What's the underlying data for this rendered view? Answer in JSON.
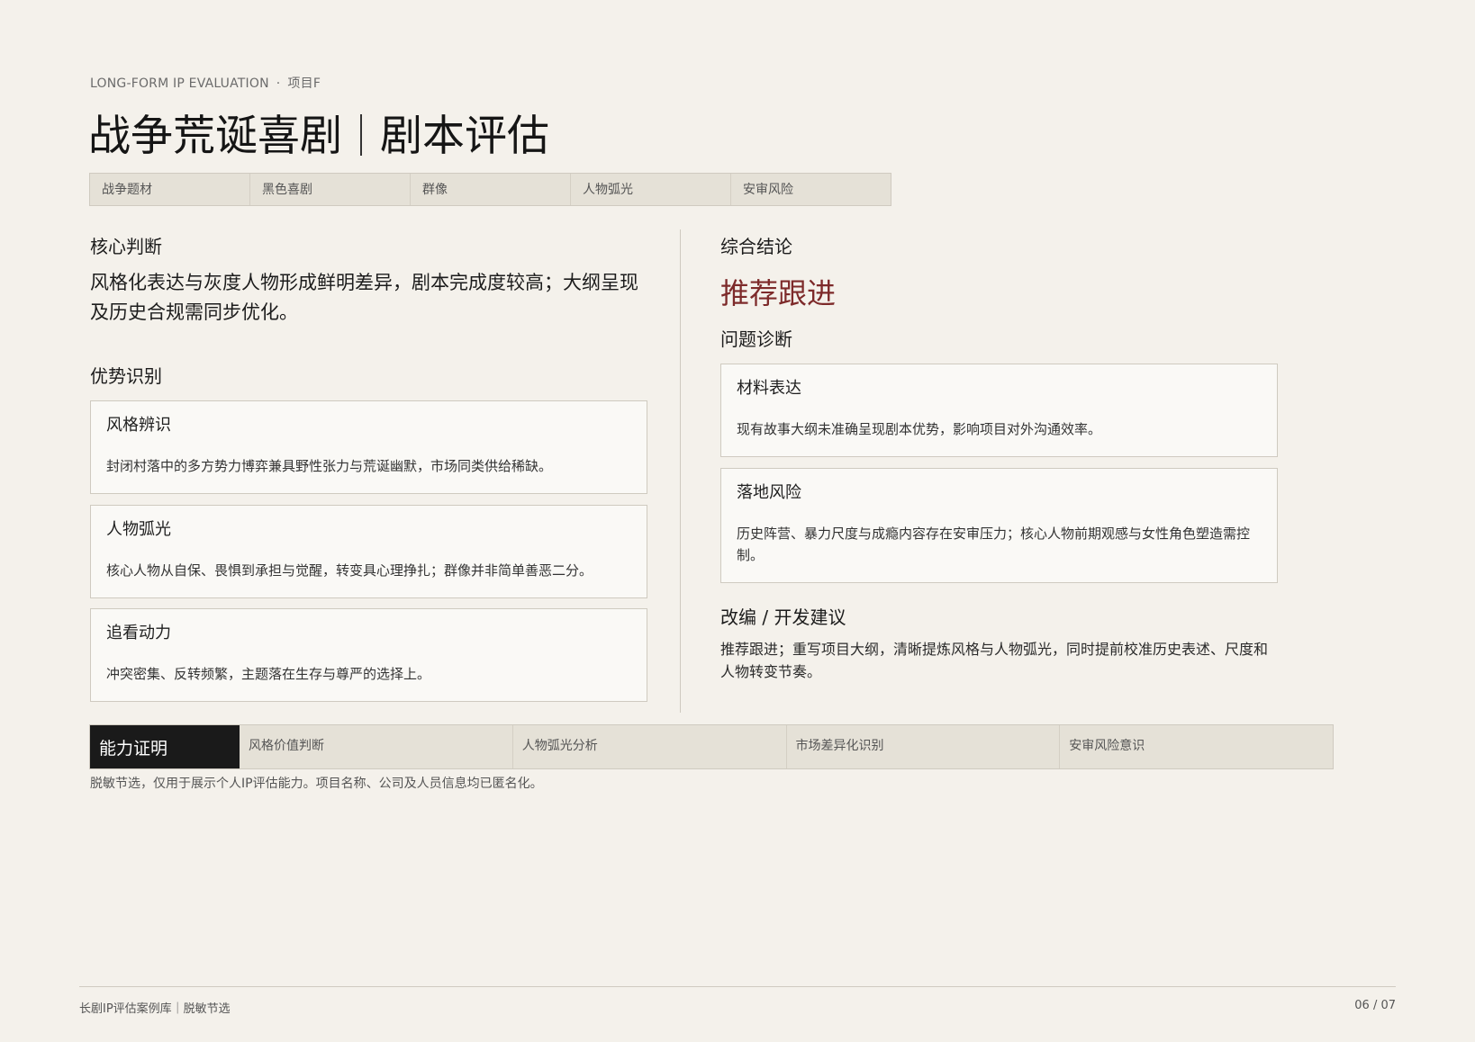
{
  "header": {
    "eyebrow": "LONG-FORM IP EVALUATION",
    "eyebrow_dot": "·",
    "project": "项目F",
    "title_main": "战争荒诞喜剧",
    "title_sub": "剧本评估"
  },
  "tags": [
    "战争题材",
    "黑色喜剧",
    "群像",
    "人物弧光",
    "安审风险"
  ],
  "core": {
    "heading": "核心判断",
    "text": "风格化表达与灰度人物形成鲜明差异，剧本完成度较高；大纲呈现及历史合规需同步优化。"
  },
  "strengths": {
    "heading": "优势识别",
    "items": [
      {
        "title": "风格辨识",
        "body": "封闭村落中的多方势力博弈兼具野性张力与荒诞幽默，市场同类供给稀缺。"
      },
      {
        "title": "人物弧光",
        "body": "核心人物从自保、畏惧到承担与觉醒，转变具心理挣扎；群像并非简单善恶二分。"
      },
      {
        "title": "追看动力",
        "body": "冲突密集、反转频繁，主题落在生存与尊严的选择上。"
      }
    ]
  },
  "conclusion": {
    "heading": "综合结论",
    "verdict": "推荐跟进"
  },
  "diagnosis": {
    "heading": "问题诊断",
    "items": [
      {
        "title": "材料表达",
        "body": "现有故事大纲未准确呈现剧本优势，影响项目对外沟通效率。"
      },
      {
        "title": "落地风险",
        "body": "历史阵营、暴力尺度与成瘾内容存在安审压力；核心人物前期观感与女性角色塑造需控制。"
      }
    ]
  },
  "advice": {
    "heading": "改编 / 开发建议",
    "text": "推荐跟进；重写项目大纲，清晰提炼风格与人物弧光，同时提前校准历史表述、尺度和人物转变节奏。"
  },
  "proof": {
    "lead": "能力证明",
    "items": [
      "风格价值判断",
      "人物弧光分析",
      "市场差异化识别",
      "安审风险意识"
    ]
  },
  "note": "脱敏节选，仅用于展示个人IP评估能力。项目名称、公司及人员信息均已匿名化。",
  "footer": {
    "left": "长剧IP评估案例库｜脱敏节选",
    "right": "06 / 07"
  },
  "colors": {
    "background": "#f4f1eb",
    "accent": "#7d2a2a",
    "dark": "#1a1a1a"
  }
}
